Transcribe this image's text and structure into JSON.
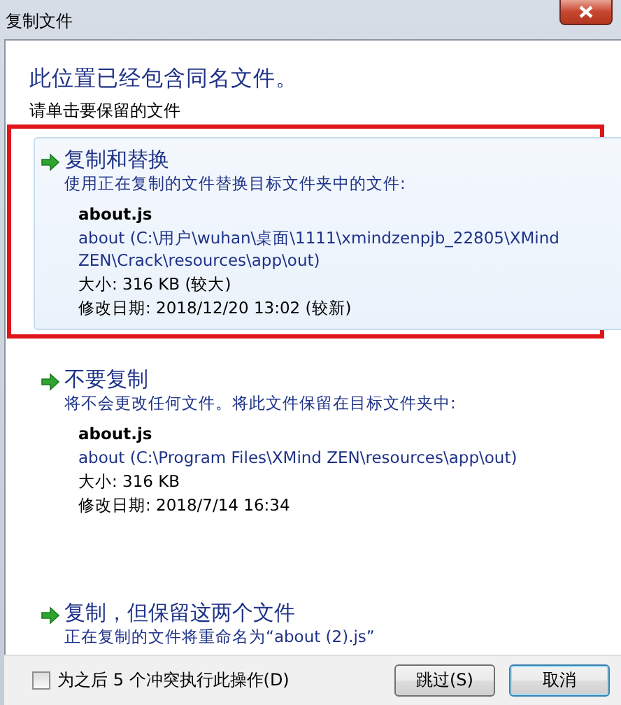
{
  "window": {
    "title": "复制文件"
  },
  "heading": "此位置已经包含同名文件。",
  "instruction": "请单击要保留的文件",
  "options": [
    {
      "kind": "file",
      "title": "复制和替换",
      "description": "使用正在复制的文件替换目标文件夹中的文件:",
      "hovered": true,
      "highlighted": true,
      "file": {
        "name": "about.js",
        "location": "about (C:\\用户\\wuhan\\桌面\\1111\\xmindzenpjb_22805\\XMind ZEN\\Crack\\resources\\app\\out)",
        "size": "大小: 316 KB (较大)",
        "modified": "修改日期: 2018/12/20 13:02 (较新)"
      }
    },
    {
      "kind": "file",
      "title": "不要复制",
      "description": "将不会更改任何文件。将此文件保留在目标文件夹中:",
      "hovered": false,
      "highlighted": false,
      "file": {
        "name": "about.js",
        "location": "about (C:\\Program Files\\XMind ZEN\\resources\\app\\out)",
        "size": "大小: 316 KB",
        "modified": "修改日期: 2018/7/14 16:34"
      }
    },
    {
      "kind": "plain",
      "title": "复制，但保留这两个文件",
      "description": "正在复制的文件将重命名为“about (2).js”",
      "hovered": false,
      "highlighted": false
    }
  ],
  "footer": {
    "checkbox": {
      "label": "为之后 5 个冲突执行此操作(D)",
      "checked": false
    },
    "buttons": [
      {
        "label": "跳过(S)",
        "default": false
      },
      {
        "label": "取消",
        "default": true
      }
    ]
  }
}
